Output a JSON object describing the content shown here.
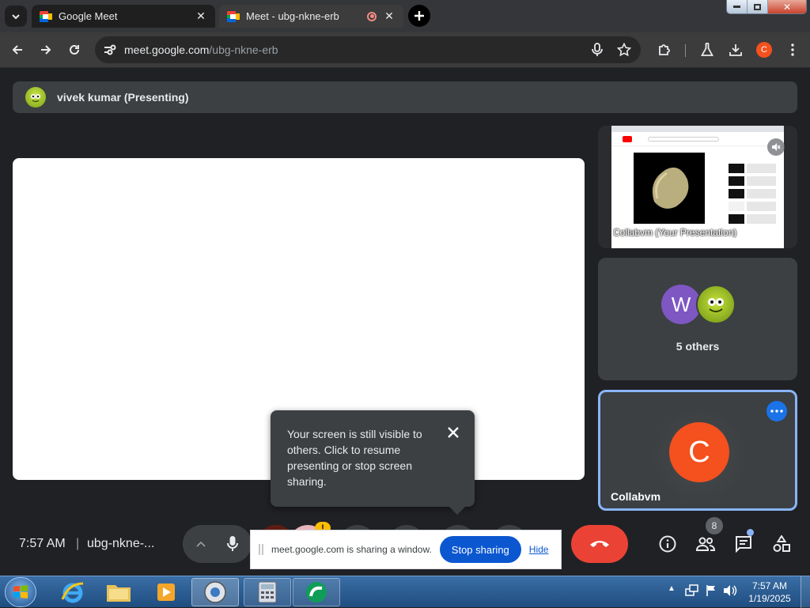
{
  "browser": {
    "tabs": [
      {
        "title": "Google Meet",
        "active": false
      },
      {
        "title": "Meet - ubg-nkne-erb",
        "active": true,
        "recording": true
      }
    ],
    "url_host": "meet.google.com",
    "url_path": "/ubg-nkne-erb",
    "profile_initial": "C"
  },
  "meeting": {
    "presenter_label": "vivek kumar (Presenting)",
    "presentation_tile_label": "Collabvm (Your Presentation)",
    "others_label": "5 others",
    "others_avatar_initial": "W",
    "self_name": "Collabvm",
    "self_initial": "C",
    "time": "7:57 AM",
    "separator": "|",
    "meeting_code": "ubg-nkne-...",
    "participants_count": "8"
  },
  "tooltip": {
    "text": "Your screen is still visible to others. Click to resume presenting or stop screen sharing."
  },
  "sharebar": {
    "message": "meet.google.com is sharing a window.",
    "stop_label": "Stop sharing",
    "hide_label": "Hide"
  },
  "taskbar": {
    "time": "7:57 AM",
    "date": "1/19/2025"
  },
  "colors": {
    "meet_bg": "#202124",
    "tile_bg": "#3c4043",
    "accent_blue": "#0b57d0",
    "end_call_red": "#ea4335",
    "avatar_orange": "#f4511e",
    "avatar_purple": "#7e57c2",
    "self_border": "#8ab4f8"
  }
}
